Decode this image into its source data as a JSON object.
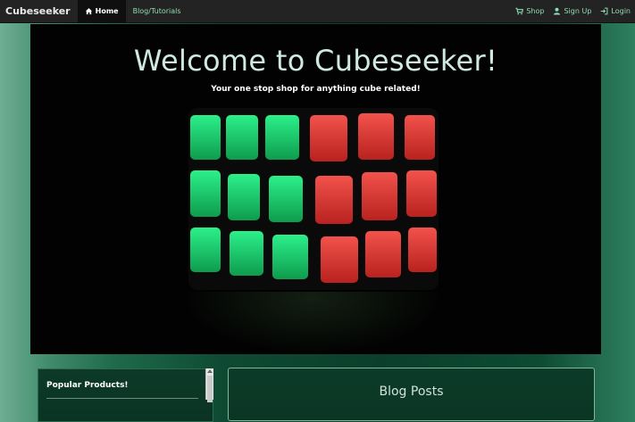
{
  "navbar": {
    "brand": "Cubeseeker",
    "home_label": "Home",
    "blog_label": "Blog/Tutorials",
    "shop_label": "Shop",
    "signup_label": "Sign Up",
    "login_label": "Login"
  },
  "hero": {
    "title": "Welcome to Cubeseeker!",
    "tagline": "Your one stop shop for anything cube related!"
  },
  "popular": {
    "title": "Popular Products!"
  },
  "blog": {
    "title": "Blog Posts"
  },
  "colors": {
    "navbar_bg": "#232323",
    "accent_link": "#8fdcb6",
    "cube_green": "#1fcf6b",
    "cube_red": "#e5413c"
  },
  "icons": {
    "home": "home-icon",
    "shop": "cart-icon",
    "signup": "user-icon",
    "login": "login-icon"
  }
}
